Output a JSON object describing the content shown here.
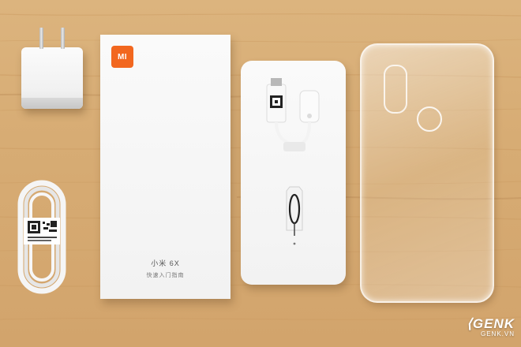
{
  "manual": {
    "logo_text": "MI",
    "title": "小米 6X",
    "subtitle": "快速入门指南"
  },
  "watermark": {
    "brand": "GENK",
    "site": "GENK.VN"
  },
  "colors": {
    "wood": "#d7ac74",
    "mi_orange": "#f2671f",
    "white_product": "#f4f4f4"
  },
  "icons": [
    "mi-logo-icon",
    "qr-code-icon",
    "sim-ejector-icon"
  ]
}
